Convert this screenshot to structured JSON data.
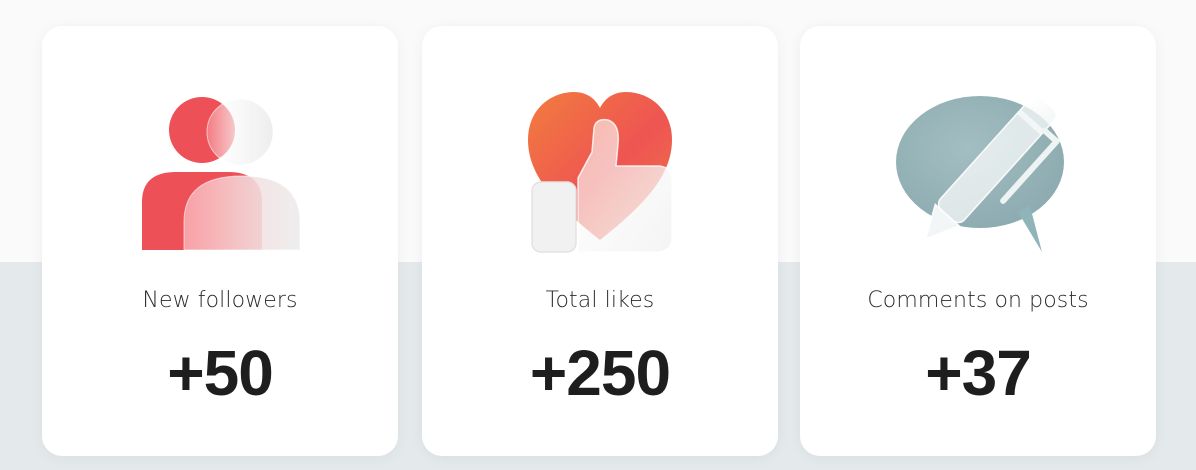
{
  "colors": {
    "page_background": "#fafafa",
    "band_background": "#e4eaeb",
    "card_background": "#ffffff",
    "followers_accent": "#ee5058",
    "likes_accent": "#f06a45",
    "comments_accent": "#96b4b8",
    "text_primary": "#1e1e1e"
  },
  "stats": [
    {
      "icon": "followers-people-icon",
      "label": "New followers",
      "value": "+50"
    },
    {
      "icon": "heart-thumbs-up-icon",
      "label": "Total likes",
      "value": "+250"
    },
    {
      "icon": "comment-pen-icon",
      "label": "Comments on posts",
      "value": "+37"
    }
  ]
}
